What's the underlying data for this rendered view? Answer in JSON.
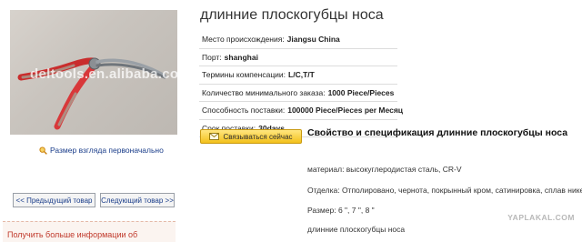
{
  "product": {
    "title": "длинние плоскогубцы носа",
    "image_watermark": "deltools.en.alibaba.com",
    "zoom_label": "Размер взгляда первоначально"
  },
  "specs": [
    {
      "label": "Место происхождения:",
      "value": "Jiangsu China"
    },
    {
      "label": "Порт:",
      "value": "shanghai"
    },
    {
      "label": "Термины компенсации:",
      "value": "L/C,T/T"
    },
    {
      "label": "Количество минимального заказа:",
      "value": "1000 Piece/Pieces"
    },
    {
      "label": "Способность поставки:",
      "value": "100000 Piece/Pieces per Месяц"
    },
    {
      "label": "Срок поставки:",
      "value": "30days"
    }
  ],
  "contact_button": {
    "label": "Связываться сейчас"
  },
  "spec_section": {
    "heading": "Свойство и спецификация длинние плоскогубцы носа",
    "lines": [
      "материал: высокуглеродистая сталь, CR-V",
      "Отделка: Отполировано, чернота, покрынный кром, сатинировка, сплав никеля",
      "Размер: 6 \", 7 \", 8 \"",
      "длинние плоскогубцы носа"
    ]
  },
  "navigation": {
    "prev_label": "<< Предыдущий товар",
    "next_label": "Следующий товар >>"
  },
  "more_info": "Получить больше информации об",
  "site_watermark": "YAPLAKAL.COM",
  "colors": {
    "accent_button": "#f3c11b",
    "link": "#1a3d8a",
    "plier_handle": "#e0393a"
  }
}
